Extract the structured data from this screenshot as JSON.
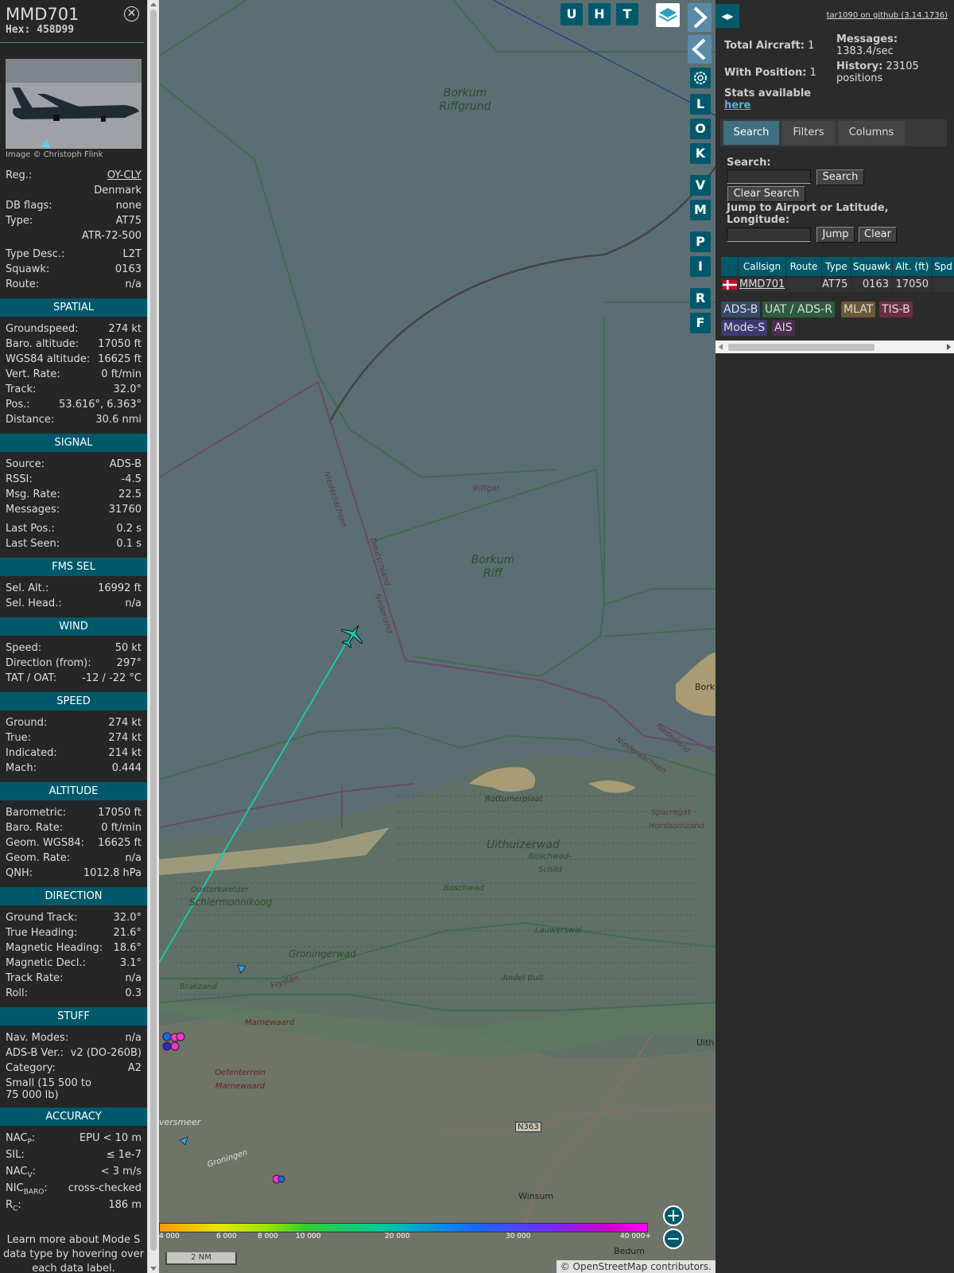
{
  "aircraft": {
    "callsign": "MMD701",
    "hex": "Hex: 458D99",
    "photo_credit": "Image © Christoph Flink",
    "reg_label": "Reg.:",
    "reg": "OY-CLY",
    "country": "Denmark",
    "dbflags_label": "DB flags:",
    "dbflags": "none",
    "type_label": "Type:",
    "type": "AT75",
    "type_name": "ATR-72-500",
    "typedesc_label": "Type Desc.:",
    "typedesc": "L2T",
    "squawk_label": "Squawk:",
    "squawk": "0163",
    "route_label": "Route:",
    "route": "n/a"
  },
  "sections": {
    "spatial": "SPATIAL",
    "signal": "SIGNAL",
    "fms": "FMS SEL",
    "wind": "WIND",
    "speed": "SPEED",
    "altitude": "ALTITUDE",
    "direction": "DIRECTION",
    "stuff": "STUFF",
    "accuracy": "ACCURACY"
  },
  "spatial": [
    {
      "k": "Groundspeed:",
      "v": "274 kt"
    },
    {
      "k": "Baro. altitude:",
      "v": "17050 ft"
    },
    {
      "k": "WGS84 altitude:",
      "v": "16625 ft"
    },
    {
      "k": "Vert. Rate:",
      "v": "0 ft/min"
    },
    {
      "k": "Track:",
      "v": "32.0°"
    },
    {
      "k": "Pos.:",
      "v": "53.616°, 6.363°"
    },
    {
      "k": "Distance:",
      "v": "30.6 nmi"
    }
  ],
  "signal": [
    {
      "k": "Source:",
      "v": "ADS-B"
    },
    {
      "k": "RSSI:",
      "v": "-4.5"
    },
    {
      "k": "Msg. Rate:",
      "v": "22.5"
    },
    {
      "k": "Messages:",
      "v": "31760"
    },
    {
      "k": "Last Pos.:",
      "v": "0.2 s"
    },
    {
      "k": "Last Seen:",
      "v": "0.1 s"
    }
  ],
  "fms": [
    {
      "k": "Sel. Alt.:",
      "v": "16992 ft"
    },
    {
      "k": "Sel. Head.:",
      "v": "n/a"
    }
  ],
  "wind": [
    {
      "k": "Speed:",
      "v": "50 kt"
    },
    {
      "k": "Direction (from):",
      "v": "297°"
    },
    {
      "k": "TAT / OAT:",
      "v": "-12 / -22 °C"
    }
  ],
  "speed": [
    {
      "k": "Ground:",
      "v": "274 kt"
    },
    {
      "k": "True:",
      "v": "274 kt"
    },
    {
      "k": "Indicated:",
      "v": "214 kt"
    },
    {
      "k": "Mach:",
      "v": "0.444"
    }
  ],
  "altitude": [
    {
      "k": "Barometric:",
      "v": "17050 ft"
    },
    {
      "k": "Baro. Rate:",
      "v": "0 ft/min"
    },
    {
      "k": "Geom. WGS84:",
      "v": "16625 ft"
    },
    {
      "k": "Geom. Rate:",
      "v": "n/a"
    },
    {
      "k": "QNH:",
      "v": "1012.8 hPa"
    }
  ],
  "direction": [
    {
      "k": "Ground Track:",
      "v": "32.0°"
    },
    {
      "k": "True Heading:",
      "v": "21.6°"
    },
    {
      "k": "Magnetic Heading:",
      "v": "18.6°"
    },
    {
      "k": "Magnetic Decl.:",
      "v": "3.1°"
    },
    {
      "k": "Track Rate:",
      "v": "n/a"
    },
    {
      "k": "Roll:",
      "v": "0.3"
    }
  ],
  "stuff": {
    "navmodes_label": "Nav. Modes:",
    "navmodes": "n/a",
    "adsbver_label": "ADS-B Ver.:",
    "adsbver": "v2 (DO-260B)",
    "category_label": "Category:",
    "category": "A2",
    "category_desc": "Small (15 500 to 75 000 lb)"
  },
  "accuracy": {
    "nacp_label": "NAC",
    "nacp_sub": "P",
    "nacp": "EPU < 10 m",
    "sil_label": "SIL:",
    "sil": "≤ 1e-7",
    "nacv_label": "NAC",
    "nacv_sub": "V",
    "nacv": "< 3 m/s",
    "nicbaro_label": "NIC",
    "nicbaro_sub": "BARO",
    "nicbaro": "cross-checked",
    "rc_label": "R",
    "rc_sub": "C",
    "rc": "186 m"
  },
  "footnote": "Learn more about Mode S data type by hovering over each data label.",
  "map": {
    "buttons_top": [
      "U",
      "H",
      "T"
    ],
    "buttons_side": [
      "L",
      "O",
      "K",
      "V",
      "M",
      "P",
      "I",
      "R",
      "F"
    ],
    "labels": {
      "borkum_riffgrund": "Borkum Riffgrund",
      "borkum_riff": "Borkum Riff",
      "riffgat": "Riffgat",
      "niedersachsen": "Niedersachsen",
      "deutschland": "Deutschland",
      "nederland": "Nederland",
      "nederland2": "Nederland",
      "niedersachsen2": "Niedersachsen",
      "borkum": "Borku",
      "rottumerplaat": "Rottumerplaat",
      "uithuizerwad": "Uithuizerwad",
      "boschwad_schild": "Boschwad-Schild",
      "boschwad": "Boschwad",
      "sparregat": "Sparregat Horsbornzand",
      "horsbornzand": "Horsbornzand",
      "oosterkwelder": "Oosterkwelder",
      "schiermonnikoog": "Schiermonnikoog",
      "lauwerswal": "Lauwerswal",
      "groningerwad": "Groningerwad",
      "fryslan": "Fryslân",
      "brakzand": "Brakzand",
      "engelsmanplaat": "Andel Bult",
      "marnewaard": "Marnewaard",
      "oefenterrein": "Oefenterrein Marnewaard",
      "lauwersmeer": "versmeer",
      "groningen": "Groningen",
      "uith": "Uith",
      "n363": "N363",
      "winsum": "Winsum",
      "bedum": "Bedum"
    },
    "colorbar_ticks": [
      "4 000",
      "6 000",
      "8 000",
      "10 000",
      "20 000",
      "30 000",
      "40 000+"
    ],
    "scale": "2 NM",
    "attribution_prefix": "© ",
    "attribution_link": "OpenStreetMap",
    "attribution_suffix": " contributors."
  },
  "right": {
    "gitlink": "tar1090 on github (3.14.1736)",
    "total_label": "Total Aircraft:",
    "total": "1",
    "withpos_label": "With Position:",
    "withpos": "1",
    "stats_label": "Stats available",
    "stats_link": "here",
    "messages_label": "Messages:",
    "messages": "1383.4/sec",
    "history_label": "History:",
    "history": "23105 positions",
    "tabs": [
      "Search",
      "Filters",
      "Columns"
    ],
    "search_label": "Search:",
    "search_value": "",
    "search_button": "Search",
    "clear_search_button": "Clear Search",
    "jump_label": "Jump to Airport or Latitude, Longitude:",
    "jump_value": "",
    "jump_button": "Jump",
    "clear_button": "Clear",
    "table_headers": [
      "Callsign",
      "Route",
      "Type",
      "Squawk",
      "Alt. (ft)",
      "Spd"
    ],
    "table_row": {
      "callsign": "MMD701",
      "route": "",
      "type": "AT75",
      "squawk": "0163",
      "alt": "17050",
      "spd": ""
    },
    "badges": [
      {
        "label": "ADS-B",
        "color": "#344a6b"
      },
      {
        "label": "UAT / ADS-R",
        "color": "#2e5a3e"
      },
      {
        "label": "MLAT",
        "color": "#6b5a34"
      },
      {
        "label": "TIS-B",
        "color": "#6b2e44"
      },
      {
        "label": "Mode-S",
        "color": "#3e3a70"
      },
      {
        "label": "AIS",
        "color": "#4a2e50"
      }
    ]
  },
  "colors": {
    "accent": "#00596b",
    "map_sea": "#5b6e73",
    "track": "#1fc2b0"
  }
}
